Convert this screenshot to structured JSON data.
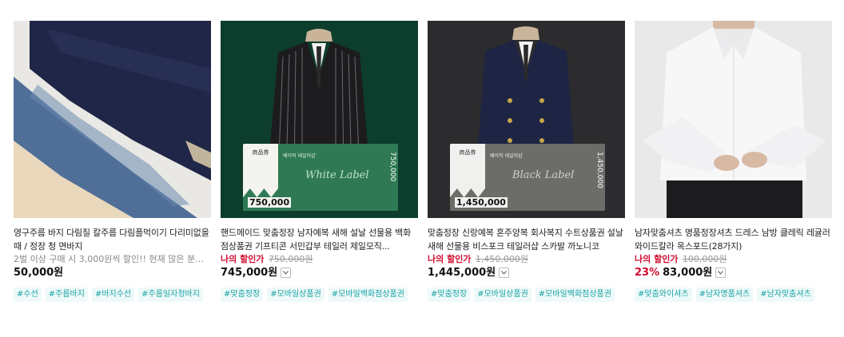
{
  "products": [
    {
      "title": "영구주름 바지 다림질 칼주름 다림플먹이기 다리미없을때 / 정장 청 면바지",
      "subtitle": "2벌 이상 구매 시 3,000원씩 할인!! 현재 많은 분들의 ...",
      "price": "50,000원",
      "tags": [
        "#수선",
        "#주름바지",
        "#바지수선",
        "#주름일자청바지"
      ]
    },
    {
      "title": "핸드메이드 맞춤정장 남자예복 새해 설날 선물용 백화점상품권 기프티콘 서민갑부 테일러 제일모직...",
      "discount_label": "나의 할인가",
      "original_price": "750,000원",
      "price": "745,000원",
      "voucher_price": "750,000",
      "voucher_header": "商品券",
      "voucher_brand": "베이직 테일러샵",
      "voucher_script": "White Label",
      "tags": [
        "#맞춤정장",
        "#모바일상품권",
        "#모바일백화점상품권"
      ]
    },
    {
      "title": "맞춤정장 신랑예복 혼주양복 회사복지 수트상품권 설날 새해 선물용 비스포크 테일러샵 스카발 까노니코",
      "discount_label": "나의 할인가",
      "original_price": "1,450,000원",
      "price": "1,445,000원",
      "voucher_price": "1,450,000",
      "voucher_header": "商品券",
      "voucher_brand": "베이직 테일러샵",
      "voucher_script": "Black Label",
      "tags": [
        "#맞춤정장",
        "#모바일상품권",
        "#모바일백화점상품권"
      ]
    },
    {
      "title": "남자맞춤셔츠 명품정장셔츠 드레스 남방 클레릭 레귤러 와이드칼라 옥스포드(28가지)",
      "discount_label": "나의 할인가",
      "original_price": "100,000원",
      "discount_percent": "23%",
      "price": "83,000원",
      "tags": [
        "#맞춤와이셔츠",
        "#남자명품셔츠",
        "#남자맞춤셔츠"
      ]
    }
  ]
}
